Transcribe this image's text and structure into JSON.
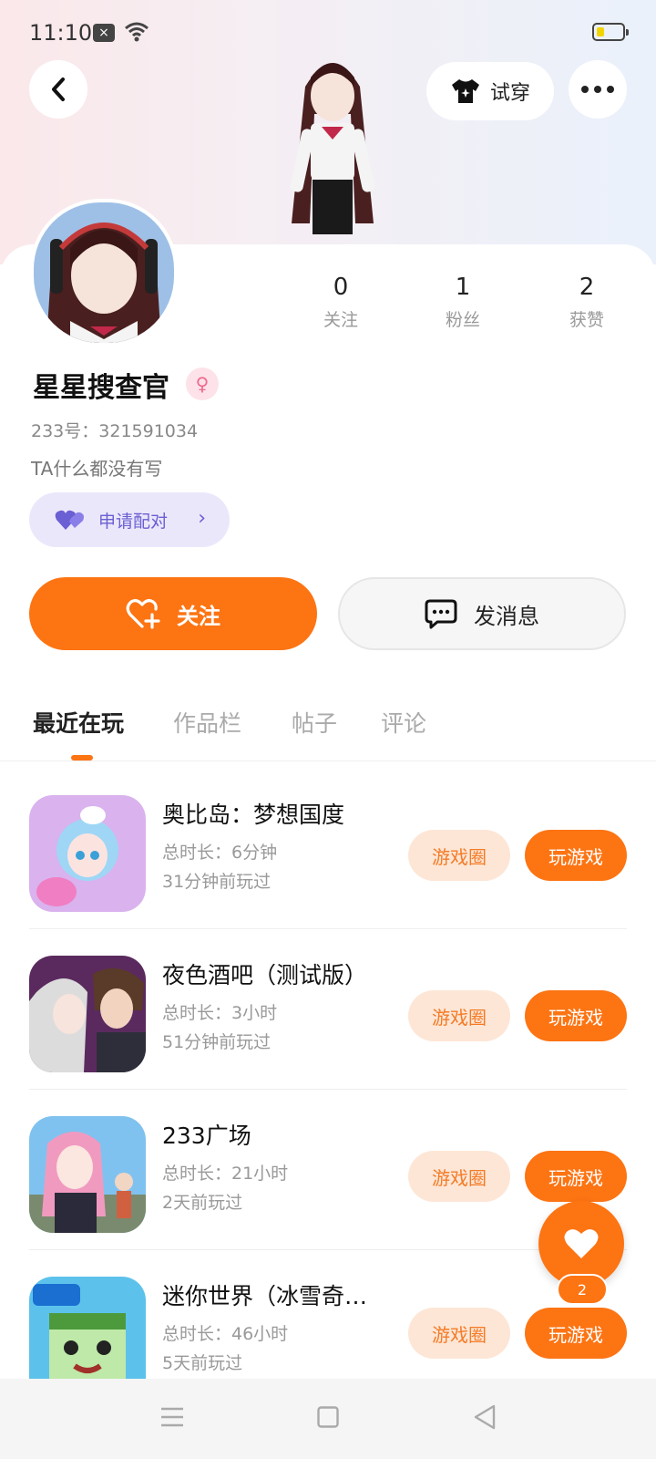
{
  "status_bar": {
    "time": "11:10",
    "notif_glyph": "×"
  },
  "header": {
    "try_on_label": "试穿"
  },
  "profile": {
    "name": "星星搜查官",
    "gender_glyph": "♀",
    "uid": "233号：321591034",
    "bio": "TA什么都没有写",
    "stats": [
      {
        "value": "0",
        "label": "关注"
      },
      {
        "value": "1",
        "label": "粉丝"
      },
      {
        "value": "2",
        "label": "获赞"
      }
    ],
    "pair_label": "申请配对",
    "follow_label": "关注",
    "message_label": "发消息"
  },
  "tabs": [
    "最近在玩",
    "作品栏",
    "帖子",
    "评论"
  ],
  "games": [
    {
      "name": "奥比岛：梦想国度",
      "total": "总时长：6分钟",
      "last": "31分钟前玩过",
      "circle_label": "游戏圈",
      "play_label": "玩游戏",
      "icon": "obi-island-icon"
    },
    {
      "name": "夜色酒吧（测试版）",
      "total": "总时长：3小时",
      "last": "51分钟前玩过",
      "circle_label": "游戏圈",
      "play_label": "玩游戏",
      "icon": "night-bar-icon"
    },
    {
      "name": "233广场",
      "total": "总时长：21小时",
      "last": "2天前玩过",
      "circle_label": "游戏圈",
      "play_label": "玩游戏",
      "icon": "plaza-233-icon"
    },
    {
      "name": "迷你世界（冰雪奇…",
      "total": "总时长：46小时",
      "last": "5天前玩过",
      "circle_label": "游戏圈",
      "play_label": "玩游戏",
      "icon": "mini-world-icon"
    }
  ],
  "fab": {
    "count": "2"
  },
  "colors": {
    "accent": "#fd7413",
    "pair_purple": "#6a5fd3"
  }
}
